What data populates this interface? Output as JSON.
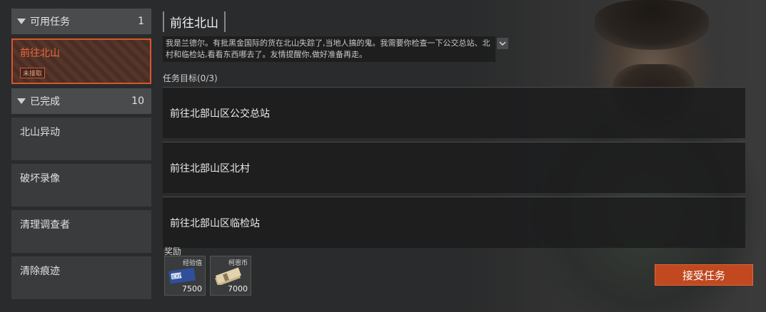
{
  "sidebar": {
    "available_group": {
      "label": "可用任务",
      "count": "1"
    },
    "active_quest": {
      "title": "前往北山",
      "badge": "未接取"
    },
    "completed_group": {
      "label": "已完成",
      "count": "10"
    },
    "completed_items": [
      {
        "label": "北山异动"
      },
      {
        "label": "破坏录像"
      },
      {
        "label": "清理调查者"
      },
      {
        "label": "清除痕迹"
      }
    ]
  },
  "quest": {
    "title": "前往北山",
    "description": "我是兰德尔。有批黑金国际的货在北山失踪了,当地人搞的鬼。我需要你检查一下公交总站、北村和临检站,看看东西哪去了。友情提醒你,做好准备再走。",
    "expand_icon": "chevron-down-icon",
    "objectives_label": "任务目标(0/3)",
    "objectives": [
      {
        "label": "前往北部山区公交总站"
      },
      {
        "label": "前往北部山区北村"
      },
      {
        "label": "前往北部山区临检站"
      }
    ]
  },
  "rewards": {
    "label": "奖励",
    "items": [
      {
        "name": "经验值",
        "amount": "7500",
        "icon": "exp-card-icon"
      },
      {
        "name": "柯恩币",
        "amount": "7000",
        "icon": "cash-stack-icon"
      }
    ]
  },
  "accept_button": {
    "label": "接受任务"
  },
  "colors": {
    "accent": "#d9552b",
    "button": "#c1481f",
    "panel": "#3a3b3c"
  }
}
